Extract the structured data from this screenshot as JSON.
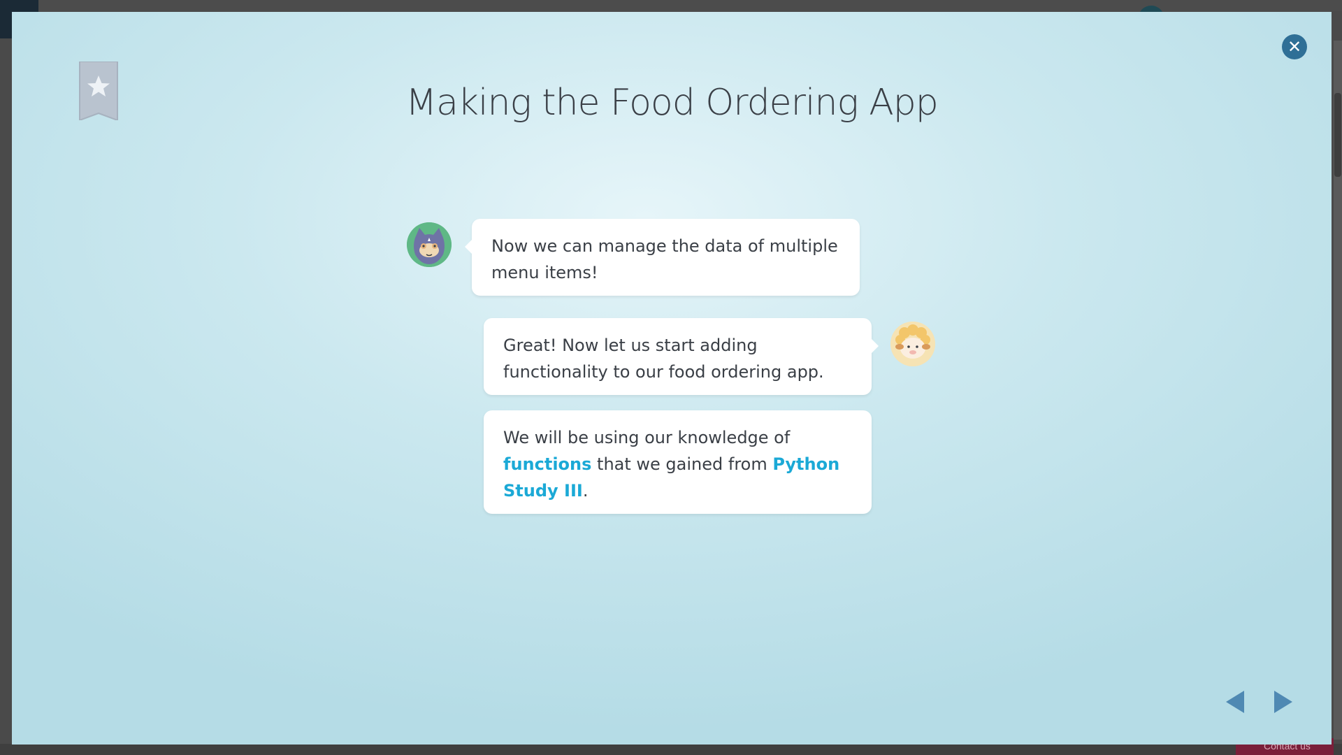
{
  "modal": {
    "title": "Making the Food Ordering App",
    "close_icon": "close-icon",
    "bookmark_icon": "bookmark-star-icon"
  },
  "dialogue": {
    "message_1": "Now we can manage the data of multiple menu items!",
    "message_2": "Great! Now let us start adding functionality to our food ordering app.",
    "message_3": {
      "part_1": "We will be using our knowledge of ",
      "highlight_1": "functions",
      "part_2": " that we gained from ",
      "highlight_2": "Python Study III",
      "part_3": "."
    }
  },
  "avatars": {
    "left": "cat-avatar",
    "right": "sheep-avatar"
  },
  "navigation": {
    "prev_icon": "triangle-left-icon",
    "next_icon": "triangle-right-icon"
  },
  "background": {
    "contact_label": "Contact us"
  },
  "colors": {
    "highlight": "#1ba9d6",
    "nav": "#4f89b3",
    "close": "#2f6f96",
    "text": "#3a3f46"
  }
}
